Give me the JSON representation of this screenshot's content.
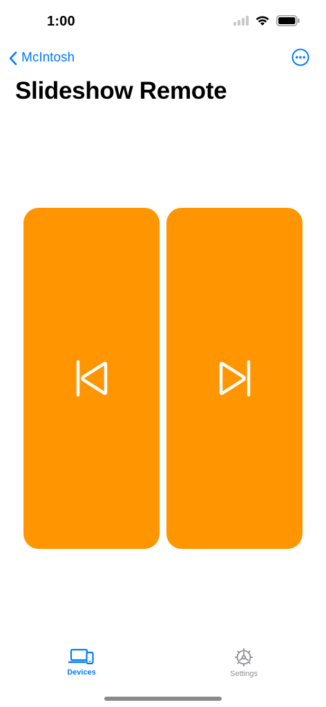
{
  "status_bar": {
    "time": "1:00"
  },
  "nav": {
    "back_label": "McIntosh"
  },
  "page": {
    "title": "Slideshow Remote"
  },
  "remote": {
    "previous_icon": "backward-end-icon",
    "next_icon": "forward-end-icon",
    "button_color": "#FF9500"
  },
  "tabs": [
    {
      "label": "Devices",
      "icon": "laptop-phone-icon",
      "selected": true
    },
    {
      "label": "Settings",
      "icon": "gear-icon",
      "selected": false
    }
  ],
  "colors": {
    "accent": "#007AFF",
    "inactive": "#8E8E93"
  }
}
